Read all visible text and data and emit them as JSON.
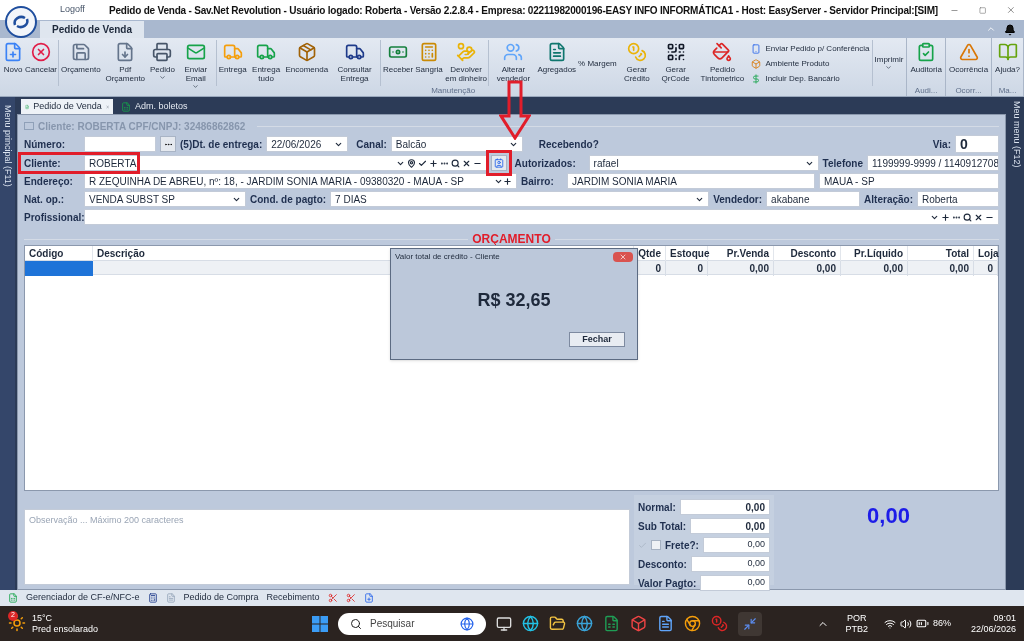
{
  "window": {
    "title": "Pedido de Venda - Sav.Net Revolution - Usuário logado: Roberta - Versão 2.2.8.4 - Empresa: 02211982000196-EASY INFO INFORMÁTICA1 - Host: EasyServer - Servidor Principal:[SIM]",
    "logoff": "Logoff"
  },
  "ribbon": {
    "tab": "Pedido de Venda",
    "groups": [
      {
        "label": "Manutenção",
        "sections": [
          [
            {
              "kind": "large",
              "label": "Novo"
            },
            {
              "kind": "large",
              "label": "Cancelar"
            }
          ],
          [
            {
              "kind": "large",
              "label": "Orçamento"
            },
            {
              "kind": "large",
              "label": "Pdf Orçamento"
            },
            {
              "kind": "large",
              "label": "Pedido",
              "dropdown": true
            },
            {
              "kind": "large",
              "label": "Enviar Email",
              "dropdown": true
            }
          ],
          [
            {
              "kind": "large",
              "label": "Entrega"
            },
            {
              "kind": "large",
              "label": "Entrega tudo"
            },
            {
              "kind": "large",
              "label": "Encomenda"
            },
            {
              "kind": "large",
              "label": "Consultar Entrega"
            }
          ],
          [
            {
              "kind": "large",
              "label": "Receber"
            },
            {
              "kind": "large",
              "label": "Sangria"
            },
            {
              "kind": "large",
              "label": "Devolver em dinheiro"
            }
          ],
          [
            {
              "kind": "large",
              "label": "Alterar vendedor"
            },
            {
              "kind": "large",
              "label": "Agregados"
            },
            {
              "kind": "text",
              "label": "% Margem"
            },
            {
              "kind": "large",
              "label": "Gerar Crédito"
            },
            {
              "kind": "large",
              "label": "Gerar QrCode"
            },
            {
              "kind": "large",
              "label": "Pedido Tintometrico"
            },
            {
              "kind": "stack",
              "items": [
                "Enviar Pedido p/ Conferência",
                "Ambiente Produto",
                "Incluir Dep. Bancário"
              ]
            }
          ],
          [
            {
              "kind": "text",
              "label": "Imprimir",
              "dropdown": true
            }
          ]
        ]
      },
      {
        "label": "Audi...",
        "sections": [
          [
            {
              "kind": "large",
              "label": "Auditoria"
            }
          ]
        ]
      },
      {
        "label": "Ocorr...",
        "sections": [
          [
            {
              "kind": "large",
              "label": "Ocorrência"
            }
          ]
        ]
      },
      {
        "label": "Ma...",
        "sections": [
          [
            {
              "kind": "large",
              "label": "Ajuda?"
            }
          ]
        ]
      }
    ]
  },
  "side_menus": {
    "left": "Menu principal (F11)",
    "right": "Meu menu (F12)"
  },
  "doc_tabs": [
    {
      "label": "Pedido de Venda",
      "selected": true
    },
    {
      "label": "Adm. boletos",
      "selected": false
    }
  ],
  "form": {
    "header": "Cliente: ROBERTA CPF/CNPJ: 32486862862",
    "numero": {
      "label": "Número:"
    },
    "dt_entrega": {
      "label": "(5)Dt. de entrega:",
      "value": "22/06/2026"
    },
    "canal": {
      "label": "Canal:",
      "value": "Balcão"
    },
    "recebendo": {
      "label": "Recebendo?"
    },
    "via": {
      "label": "Via:",
      "value": "0"
    },
    "cliente": {
      "label": "Cliente:",
      "value": "ROBERTA"
    },
    "autorizados": {
      "label": "Autorizados:",
      "value": "rafael"
    },
    "telefone": {
      "label": "Telefone",
      "value": "1199999-9999 / 1140912708"
    },
    "endereco": {
      "label": "Endereço:",
      "value": "R ZEQUINHA DE ABREU, nº: 18,  - JARDIM SONIA MARIA - 09380320 - MAUA - SP"
    },
    "bairro": {
      "label": "Bairro:",
      "value": "JARDIM SONIA MARIA"
    },
    "cidade": {
      "value": "MAUA - SP"
    },
    "nat_op": {
      "label": "Nat. op.:",
      "value": "VENDA SUBST SP"
    },
    "cond_pagto": {
      "label": "Cond. de pagto:",
      "value": "7 DIAS"
    },
    "vendedor": {
      "label": "Vendedor:",
      "value": "akabane"
    },
    "alteracao": {
      "label": "Alteração:",
      "value": "Roberta"
    },
    "profissional": {
      "label": "Profissional:"
    }
  },
  "section_title": "ORÇAMENTO",
  "items_table": {
    "columns": [
      "Código",
      "Descrição",
      "Qtde",
      "Estoque",
      "Pr.Venda",
      "Desconto",
      "Pr.Líquido",
      "Total",
      "Loja"
    ],
    "rows": [
      {
        "values": [
          "0",
          "0",
          "0,00",
          "0,00",
          "0,00",
          "0,00",
          "0"
        ]
      }
    ]
  },
  "dialog": {
    "title": "Valor total de crédito - Cliente",
    "amount": "R$ 32,65",
    "button": "Fechar"
  },
  "observacao": {
    "placeholder": "Observação ... Máximo 200 caracteres"
  },
  "totals": [
    {
      "kind": "plain",
      "label": "Normal:",
      "value": "0,00",
      "emphasis": true
    },
    {
      "kind": "plain",
      "label": "Sub Total:",
      "value": "0,00",
      "emphasis": true
    },
    {
      "kind": "frete",
      "label": "Frete?:",
      "value": "0,00",
      "emphasis": false,
      "checked": false
    },
    {
      "kind": "plain",
      "label": "Desconto:",
      "value": "0,00",
      "emphasis": false
    },
    {
      "kind": "plain",
      "label": "Valor Pagto:",
      "value": "0,00",
      "emphasis": false
    }
  ],
  "grand_total": "0,00",
  "bottom_toolbar": [
    "Gerenciador de CF-e/NFC-e",
    "Pedido de Compra",
    "Recebimento"
  ],
  "taskbar": {
    "weather": {
      "badge": "2",
      "temp": "15°C",
      "desc": "Pred ensolarado"
    },
    "search": {
      "placeholder": "Pesquisar"
    },
    "lang": "POR",
    "layout": "PTB2",
    "battery": "86%",
    "time": "09:01",
    "date": "22/06/2026"
  }
}
